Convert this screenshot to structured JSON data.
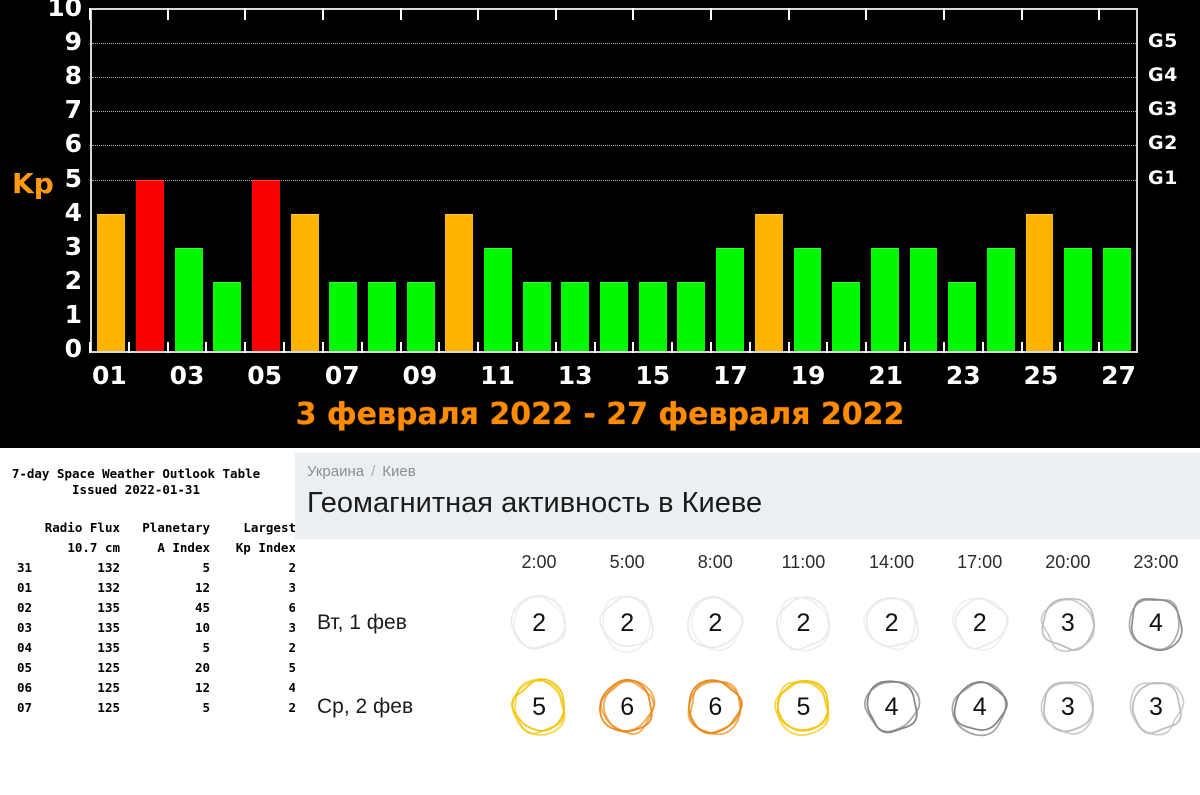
{
  "chart_data": {
    "type": "bar",
    "title": "",
    "subtitle": "3 февраля 2022 - 27 февраля 2022",
    "ylabel": "Kp",
    "xlabel": "",
    "ylim": [
      0,
      10
    ],
    "grid": true,
    "background": "#000000",
    "categories": [
      "01",
      "02",
      "03",
      "04",
      "05",
      "06",
      "07",
      "08",
      "09",
      "10",
      "11",
      "12",
      "13",
      "14",
      "15",
      "16",
      "17",
      "18",
      "19",
      "20",
      "21",
      "22",
      "23",
      "24",
      "25",
      "26",
      "27"
    ],
    "x_tick_labels": [
      "01",
      "",
      "03",
      "",
      "05",
      "",
      "07",
      "",
      "09",
      "",
      "11",
      "",
      "13",
      "",
      "15",
      "",
      "17",
      "",
      "19",
      "",
      "21",
      "",
      "23",
      "",
      "25",
      "",
      "27"
    ],
    "y_tick_labels": [
      "0",
      "1",
      "2",
      "3",
      "4",
      "5",
      "6",
      "7",
      "8",
      "9",
      "10"
    ],
    "right_axis_labels": [
      {
        "label": "G1",
        "value": 5
      },
      {
        "label": "G2",
        "value": 6
      },
      {
        "label": "G3",
        "value": 7
      },
      {
        "label": "G4",
        "value": 8
      },
      {
        "label": "G5",
        "value": 9
      }
    ],
    "values": [
      4,
      5,
      3,
      2,
      5,
      4,
      2,
      2,
      2,
      4,
      3,
      2,
      2,
      2,
      2,
      2,
      3,
      4,
      3,
      2,
      3,
      3,
      2,
      3,
      4,
      3,
      3
    ],
    "bar_colors": [
      "#ffb400",
      "#f90000",
      "#00f900",
      "#00f900",
      "#f90000",
      "#ffb400",
      "#00f900",
      "#00f900",
      "#00f900",
      "#ffb400",
      "#00f900",
      "#00f900",
      "#00f900",
      "#00f900",
      "#00f900",
      "#00f900",
      "#00f900",
      "#ffb400",
      "#00f900",
      "#00f900",
      "#00f900",
      "#00f900",
      "#00f900",
      "#00f900",
      "#ffb400",
      "#00f900",
      "#00f900"
    ],
    "color_legend": {
      "quiet_green": "#00f900",
      "active_orange": "#ffb400",
      "storm_red": "#f90000",
      "axis_text": "#ffffff",
      "accent_orange": "#ff8c00"
    }
  },
  "outlook": {
    "title_line1": "7-day Space Weather Outlook Table",
    "title_line2": "Issued 2022-01-31",
    "columns": [
      {
        "line1": "",
        "line2": ""
      },
      {
        "line1": "Radio Flux",
        "line2": "10.7 cm"
      },
      {
        "line1": "Planetary",
        "line2": "A Index"
      },
      {
        "line1": "Largest",
        "line2": "Kp Index"
      }
    ],
    "rows": [
      {
        "date": "31",
        "flux": "132",
        "a_index": "5",
        "kp": "2"
      },
      {
        "date": "01",
        "flux": "132",
        "a_index": "12",
        "kp": "3"
      },
      {
        "date": "02",
        "flux": "135",
        "a_index": "45",
        "kp": "6"
      },
      {
        "date": "03",
        "flux": "135",
        "a_index": "10",
        "kp": "3"
      },
      {
        "date": "04",
        "flux": "135",
        "a_index": "5",
        "kp": "2"
      },
      {
        "date": "05",
        "flux": "125",
        "a_index": "20",
        "kp": "5"
      },
      {
        "date": "06",
        "flux": "125",
        "a_index": "12",
        "kp": "4"
      },
      {
        "date": "07",
        "flux": "125",
        "a_index": "5",
        "kp": "2"
      }
    ]
  },
  "geo": {
    "breadcrumb": {
      "country": "Украина",
      "separator": "/",
      "city": "Киев"
    },
    "title": "Геомагнитная активность в Киеве",
    "time_columns": [
      "2:00",
      "5:00",
      "8:00",
      "11:00",
      "14:00",
      "17:00",
      "20:00",
      "23:00"
    ],
    "rows": [
      {
        "day_label": "Вт, 1 фев",
        "values": [
          "2",
          "2",
          "2",
          "2",
          "2",
          "2",
          "3",
          "4"
        ],
        "colors": [
          "#e9e9e9",
          "#e9e9e9",
          "#e9e9e9",
          "#e9e9e9",
          "#e9e9e9",
          "#e9e9e9",
          "#b9b9b9",
          "#8a8a8a"
        ]
      },
      {
        "day_label": "Ср, 2 фев",
        "values": [
          "5",
          "6",
          "6",
          "5",
          "4",
          "4",
          "3",
          "3"
        ],
        "colors": [
          "#f2c300",
          "#e8860f",
          "#e8860f",
          "#f2c300",
          "#7d7d7d",
          "#7d7d7d",
          "#b9b9b9",
          "#b9b9b9"
        ]
      }
    ]
  }
}
